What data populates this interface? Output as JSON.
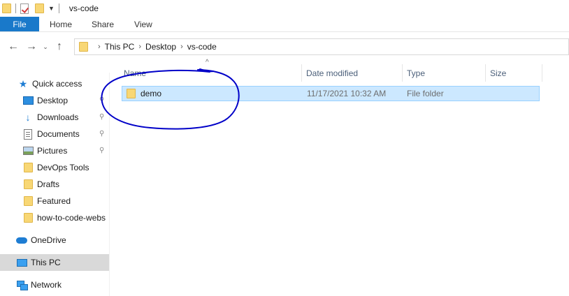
{
  "window": {
    "title": "vs-code"
  },
  "ribbon": {
    "tabs": [
      "File",
      "Home",
      "Share",
      "View"
    ]
  },
  "address": {
    "crumbs": [
      "This PC",
      "Desktop",
      "vs-code"
    ]
  },
  "sidebar": {
    "items": [
      {
        "label": "Quick access",
        "icon": "star-icon",
        "pinned": false
      },
      {
        "label": "Desktop",
        "icon": "desktop-icon",
        "pinned": true
      },
      {
        "label": "Downloads",
        "icon": "download-icon",
        "pinned": true
      },
      {
        "label": "Documents",
        "icon": "documents-icon",
        "pinned": true
      },
      {
        "label": "Pictures",
        "icon": "pictures-icon",
        "pinned": true
      },
      {
        "label": "DevOps Tools",
        "icon": "folder-icon",
        "pinned": false
      },
      {
        "label": "Drafts",
        "icon": "folder-icon",
        "pinned": false
      },
      {
        "label": "Featured",
        "icon": "folder-icon",
        "pinned": false
      },
      {
        "label": "how-to-code-webs",
        "icon": "folder-icon",
        "pinned": false
      },
      {
        "label": "OneDrive",
        "icon": "onedrive-icon",
        "pinned": false
      },
      {
        "label": "This PC",
        "icon": "this-pc-icon",
        "pinned": false,
        "selected": true
      },
      {
        "label": "Network",
        "icon": "network-icon",
        "pinned": false
      }
    ]
  },
  "columns": {
    "name": "Name",
    "date": "Date modified",
    "type": "Type",
    "size": "Size"
  },
  "files": [
    {
      "name": "demo",
      "date": "11/17/2021 10:32 AM",
      "type": "File folder",
      "size": ""
    }
  ],
  "colors": {
    "accent": "#1979ca",
    "selection": "#cce8ff",
    "annotation": "#0000c8"
  }
}
